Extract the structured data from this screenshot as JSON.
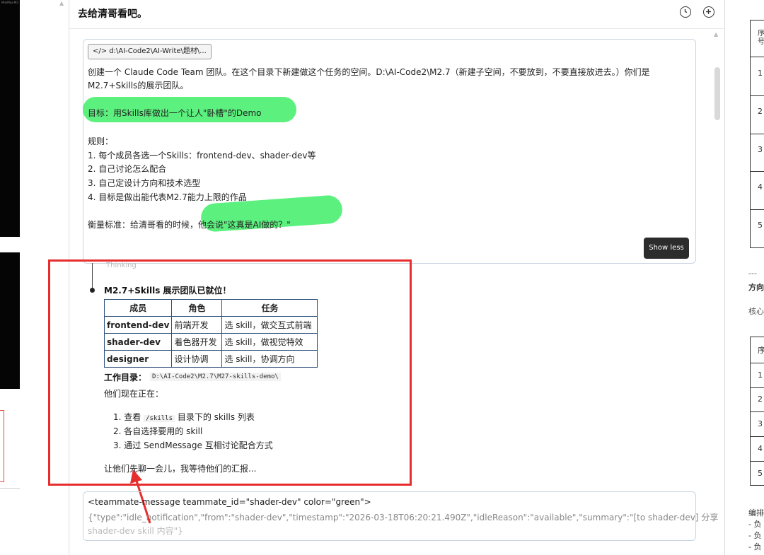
{
  "left_strip": {
    "tiny_text": "MiniMax-M2"
  },
  "header": {
    "title": "去给清哥看吧。",
    "history_icon": "clock-icon",
    "new_icon": "plus-circle-icon"
  },
  "prompt": {
    "file_chip": "</> d:\\AI-Code2\\AI-Write\\题材\\...",
    "line1": "创建一个 Claude Code Team 团队。在这个目录下新建做这个任务的空间。D:\\AI-Code2\\M2.7（新建子空间，不要放到，不要直接放进去。）你们是",
    "line2": "M2.7+Skills的展示团队。",
    "goal": "目标：用Skills库做出一个让人\"卧槽\"的Demo",
    "rules_title": "规则：",
    "rules": [
      "1. 每个成员各选一个Skills：frontend-dev、shader-dev等",
      "2. 自己讨论怎么配合",
      "3. 自己定设计方向和技术选型",
      "4. 目标是做出能代表M2.7能力上限的作品"
    ],
    "measure_prefix": "衡量标准：给清哥看的时候，",
    "measure_highlight": "他会说\"这真是AI做的？\"",
    "show_less": "Show less"
  },
  "response": {
    "thinking": "Thinking",
    "title": "M2.7+Skills 展示团队已就位！",
    "table_headers": [
      "成员",
      "角色",
      "任务"
    ],
    "table_rows": [
      [
        "frontend-dev",
        "前端开发",
        "选 skill，做交互式前端"
      ],
      [
        "shader-dev",
        "着色器开发",
        "选 skill，做视觉特效"
      ],
      [
        "designer",
        "设计协调",
        "选 skill，协调方向"
      ]
    ],
    "workdir_label": "工作目录：",
    "workdir_path": "D:\\AI-Code2\\M2.7\\M27-skills-demo\\",
    "now_doing": "他们现在正在：",
    "step1_prefix": "1. 查看 ",
    "step1_code": "/skills",
    "step1_suffix": " 目录下的 skills 列表",
    "step2": "2. 各自选择要用的 skill",
    "step3": "3. 通过 SendMessage 互相讨论配合方式",
    "closing": "让他们先聊一会儿，我等待他们的汇报..."
  },
  "teammate_message": {
    "line1": "<teammate-message teammate_id=\"shader-dev\" color=\"green\">",
    "line2": "{\"type\":\"idle_notification\",\"from\":\"shader-dev\",\"timestamp\":\"2026-03-18T06:20:21.490Z\",\"idleReason\":\"available\",\"summary\":\"[to shader-dev] 分享",
    "line3": "shader-dev skill 内容\"}"
  },
  "right_strip": {
    "table1_header": "序号",
    "table1_nums": [
      "1",
      "2",
      "3",
      "4",
      "5"
    ],
    "dashes": "---",
    "heading": "方向",
    "core": "核心",
    "table2_header": "序",
    "table2_nums": [
      "1",
      "2",
      "3",
      "4",
      "5"
    ],
    "footer1": "编排",
    "footer2": "- 负",
    "footer3": "- 负",
    "footer4": "- 负"
  },
  "colors": {
    "highlight": "#5cf07e",
    "annotation": "#e62e2e",
    "table_border": "#2b4e7a"
  }
}
